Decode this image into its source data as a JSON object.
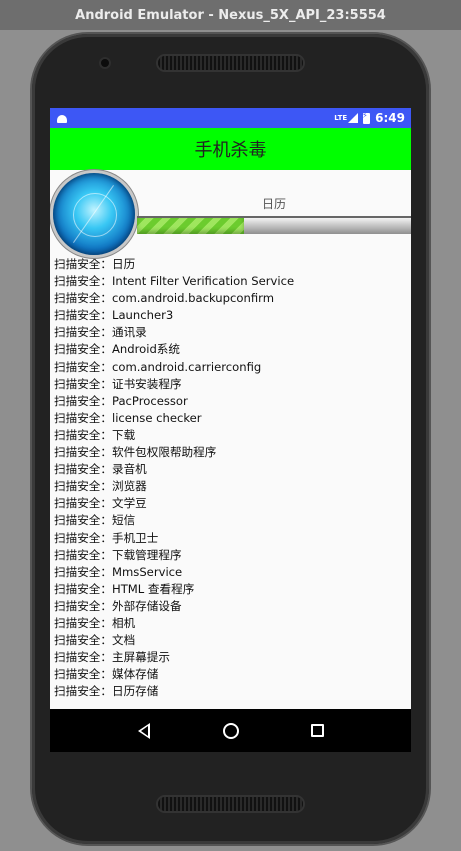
{
  "window": {
    "title": "Android Emulator - Nexus_5X_API_23:5554"
  },
  "status_bar": {
    "network": "LTE",
    "time": "6:49"
  },
  "app_bar": {
    "title": "手机杀毒"
  },
  "scan": {
    "current_app": "日历",
    "progress": 0.39
  },
  "log": {
    "items": [
      {
        "prefix": "扫描安全：",
        "name": "日历"
      },
      {
        "prefix": "扫描安全：",
        "name": "Intent Filter Verification Service"
      },
      {
        "prefix": "扫描安全：",
        "name": "com.android.backupconfirm"
      },
      {
        "prefix": "扫描安全：",
        "name": "Launcher3"
      },
      {
        "prefix": "扫描安全：",
        "name": "通讯录"
      },
      {
        "prefix": "扫描安全：",
        "name": "Android系统"
      },
      {
        "prefix": "扫描安全：",
        "name": "com.android.carrierconfig"
      },
      {
        "prefix": "扫描安全：",
        "name": "证书安装程序"
      },
      {
        "prefix": "扫描安全：",
        "name": "PacProcessor"
      },
      {
        "prefix": "扫描安全：",
        "name": "license checker"
      },
      {
        "prefix": "扫描安全：",
        "name": "下载"
      },
      {
        "prefix": "扫描安全：",
        "name": "软件包权限帮助程序"
      },
      {
        "prefix": "扫描安全：",
        "name": "录音机"
      },
      {
        "prefix": "扫描安全：",
        "name": "浏览器"
      },
      {
        "prefix": "扫描安全：",
        "name": "文学豆"
      },
      {
        "prefix": "扫描安全：",
        "name": "短信"
      },
      {
        "prefix": "扫描安全：",
        "name": "手机卫士"
      },
      {
        "prefix": "扫描安全：",
        "name": "下载管理程序"
      },
      {
        "prefix": "扫描安全：",
        "name": "MmsService"
      },
      {
        "prefix": "扫描安全：",
        "name": "HTML 查看程序"
      },
      {
        "prefix": "扫描安全：",
        "name": "外部存储设备"
      },
      {
        "prefix": "扫描安全：",
        "name": "相机"
      },
      {
        "prefix": "扫描安全：",
        "name": "文档"
      },
      {
        "prefix": "扫描安全：",
        "name": "主屏幕提示"
      },
      {
        "prefix": "扫描安全：",
        "name": "媒体存储"
      },
      {
        "prefix": "扫描安全：",
        "name": "日历存储"
      }
    ]
  },
  "nav": {
    "back_icon": "back-triangle-icon",
    "home_icon": "home-circle-icon",
    "recent_icon": "recent-apps-square-icon"
  }
}
